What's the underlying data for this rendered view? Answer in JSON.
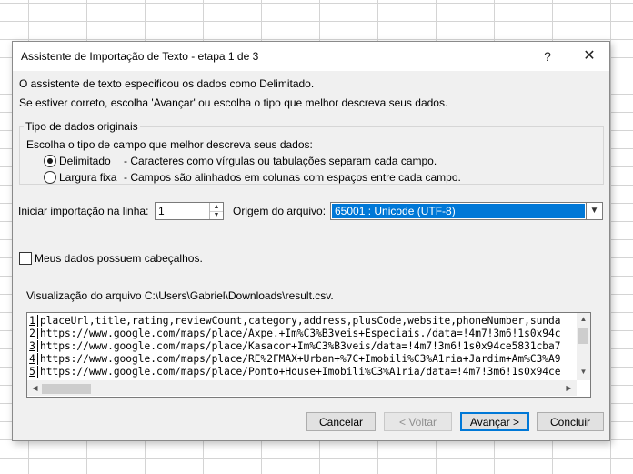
{
  "dialog": {
    "title": "Assistente de Importação de Texto - etapa 1 de 3",
    "help_label": "?",
    "close_label": "✕"
  },
  "intro": {
    "line1": "O assistente de texto especificou os dados como Delimitado.",
    "line2": "Se estiver correto, escolha 'Avançar' ou escolha o tipo que melhor descreva seus dados."
  },
  "data_type_group": {
    "legend": "Tipo de dados originais",
    "prompt": "Escolha o tipo de campo que melhor descreva seus dados:",
    "options": [
      {
        "label": "Delimitado",
        "description": "- Caracteres como vírgulas ou tabulações separam cada campo.",
        "selected": true
      },
      {
        "label": "Largura fixa",
        "description": "- Campos são alinhados em colunas com espaços entre cada campo.",
        "selected": false
      }
    ]
  },
  "start_row": {
    "label": "Iniciar importação na linha:",
    "value": "1"
  },
  "file_origin": {
    "label": "Origem do arquivo:",
    "value": "65001 : Unicode (UTF-8)"
  },
  "headers_checkbox": {
    "label": "Meus dados possuem cabeçalhos.",
    "checked": false
  },
  "preview": {
    "label": "Visualização do arquivo C:\\Users\\Gabriel\\Downloads\\result.csv.",
    "lines": [
      {
        "num": "1",
        "text": "placeUrl,title,rating,reviewCount,category,address,plusCode,website,phoneNumber,sunda"
      },
      {
        "num": "2",
        "text": "https://www.google.com/maps/place/Axpe.+Im%C3%B3veis+Especiais./data=!4m7!3m6!1s0x94c"
      },
      {
        "num": "3",
        "text": "https://www.google.com/maps/place/Kasacor+Im%C3%B3veis/data=!4m7!3m6!1s0x94ce5831cba7"
      },
      {
        "num": "4",
        "text": "https://www.google.com/maps/place/RE%2FMAX+Urban+%7C+Imobili%C3%A1ria+Jardim+Am%C3%A9"
      },
      {
        "num": "5",
        "text": "https://www.google.com/maps/place/Ponto+House+Imobili%C3%A1ria/data=!4m7!3m6!1s0x94ce"
      }
    ]
  },
  "buttons": {
    "cancel": "Cancelar",
    "back": "< Voltar",
    "next": "Avançar >",
    "finish": "Concluir"
  }
}
